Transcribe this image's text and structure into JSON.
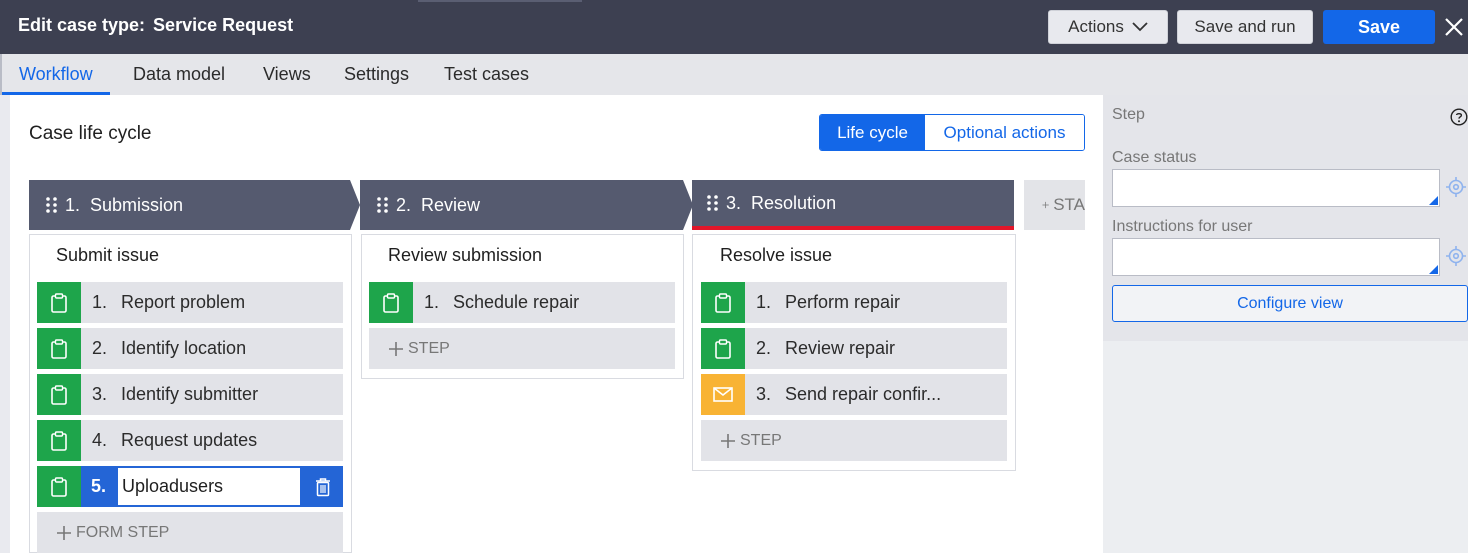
{
  "header": {
    "title_prefix": "Edit case type:",
    "title_name": "Service Request",
    "actions_label": "Actions",
    "save_and_run_label": "Save and run",
    "save_label": "Save"
  },
  "tabs": [
    {
      "label": "Workflow",
      "active": true
    },
    {
      "label": "Data model"
    },
    {
      "label": "Views"
    },
    {
      "label": "Settings"
    },
    {
      "label": "Test cases"
    }
  ],
  "canvas": {
    "title": "Case life cycle",
    "toggle": {
      "life_cycle": "Life cycle",
      "optional_actions": "Optional actions"
    },
    "add_stage_label": "STA"
  },
  "stages": [
    {
      "number": "1.",
      "name": "Submission",
      "process": "Submit issue",
      "steps": [
        {
          "num": "1.",
          "label": "Report problem",
          "icon": "clipboard-icon",
          "color": "#1ea54b"
        },
        {
          "num": "2.",
          "label": "Identify location",
          "icon": "clipboard-icon",
          "color": "#1ea54b"
        },
        {
          "num": "3.",
          "label": "Identify submitter",
          "icon": "clipboard-icon",
          "color": "#1ea54b"
        },
        {
          "num": "4.",
          "label": "Request updates",
          "icon": "clipboard-icon",
          "color": "#1ea54b"
        }
      ],
      "editing_step": {
        "num": "5.",
        "value": "Uploadusers"
      },
      "add_label": "FORM STEP"
    },
    {
      "number": "2.",
      "name": "Review",
      "process": "Review submission",
      "steps": [
        {
          "num": "1.",
          "label": "Schedule repair",
          "icon": "clipboard-icon",
          "color": "#1ea54b"
        }
      ],
      "add_label": "STEP"
    },
    {
      "number": "3.",
      "name": "Resolution",
      "process": "Resolve issue",
      "steps": [
        {
          "num": "1.",
          "label": "Perform repair",
          "icon": "clipboard-icon",
          "color": "#1ea54b"
        },
        {
          "num": "2.",
          "label": "Review repair",
          "icon": "clipboard-icon",
          "color": "#1ea54b"
        },
        {
          "num": "3.",
          "label": "Send repair confir...",
          "icon": "envelope-icon",
          "color": "#f8b334"
        }
      ],
      "add_label": "STEP"
    }
  ],
  "right_panel": {
    "section_label": "Step",
    "case_status_label": "Case status",
    "case_status_value": "",
    "instructions_label": "Instructions for user",
    "instructions_value": "",
    "configure_view_label": "Configure view"
  },
  "colors": {
    "accent": "#1367e8",
    "header_bg": "#3d4051",
    "stage_bg": "#555a6f",
    "step_green": "#1ea54b",
    "step_orange": "#f8b334",
    "active_stage_underline": "#e2162a"
  }
}
